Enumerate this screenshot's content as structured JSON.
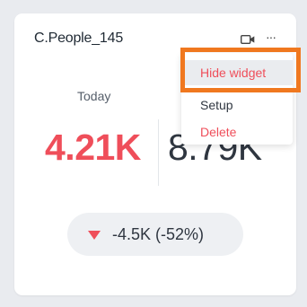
{
  "widget": {
    "title": "C.People_145",
    "today_label": "Today",
    "today_value": "4.21K",
    "compare_value": "8.79K",
    "change_text": "-4.5K (-52%)"
  },
  "header": {
    "icons": [
      "video-icon",
      "more-icon"
    ],
    "more_glyph": "···"
  },
  "menu": {
    "items": [
      {
        "label": "Hide widget",
        "highlighted": true
      },
      {
        "label": "Setup"
      },
      {
        "label": "Delete"
      }
    ]
  },
  "colors": {
    "accent_red": "#ef4e5a",
    "highlight_orange": "#f0781f",
    "text_dark": "#2f3640"
  }
}
